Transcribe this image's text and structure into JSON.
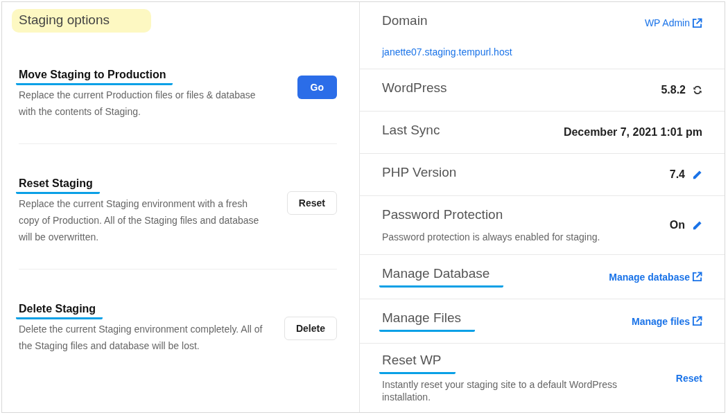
{
  "title": {
    "text": "Staging options",
    "highlighted": true
  },
  "actions": [
    {
      "title": "Move Staging to Production",
      "underlined": true,
      "description": "Replace the current Production files or files & database with the contents of Staging.",
      "button": {
        "label": "Go",
        "kind": "primary"
      }
    },
    {
      "title": "Reset Staging",
      "underlined": true,
      "description": "Replace the current Staging environment with a fresh copy of Production. All of the Staging files and database will be overwritten.",
      "button": {
        "label": "Reset",
        "kind": "secondary"
      }
    },
    {
      "title": "Delete Staging",
      "underlined": true,
      "description": "Delete the current Staging environment completely. All of the Staging files and database will be lost.",
      "button": {
        "label": "Delete",
        "kind": "secondary"
      }
    }
  ],
  "details": [
    {
      "label": "Domain",
      "underlined": false,
      "link": "janette07.staging.tempurl.host",
      "action": {
        "text": "WP Admin",
        "kind": "external",
        "bold": false
      }
    },
    {
      "label": "WordPress",
      "underlined": false,
      "value": "5.8.2",
      "value_icon": {
        "kind": "sync"
      }
    },
    {
      "label": "Last Sync",
      "underlined": false,
      "value": "December 7, 2021 1:01 pm"
    },
    {
      "label": "PHP Version",
      "underlined": false,
      "value": "7.4",
      "value_icon": {
        "kind": "edit"
      }
    },
    {
      "label": "Password Protection",
      "underlined": false,
      "description": "Password protection is always enabled for staging.",
      "value": "On",
      "value_icon": {
        "kind": "edit"
      }
    },
    {
      "label": "Manage Database",
      "underlined": true,
      "action": {
        "text": "Manage database",
        "kind": "external",
        "bold": true
      }
    },
    {
      "label": "Manage Files",
      "underlined": true,
      "action": {
        "text": "Manage files",
        "kind": "external",
        "bold": true
      }
    },
    {
      "label": "Reset WP",
      "underlined": true,
      "description": "Instantly reset your staging site to a default WordPress installation.",
      "action": {
        "text": "Reset",
        "kind": "plain",
        "bold": true
      }
    }
  ]
}
